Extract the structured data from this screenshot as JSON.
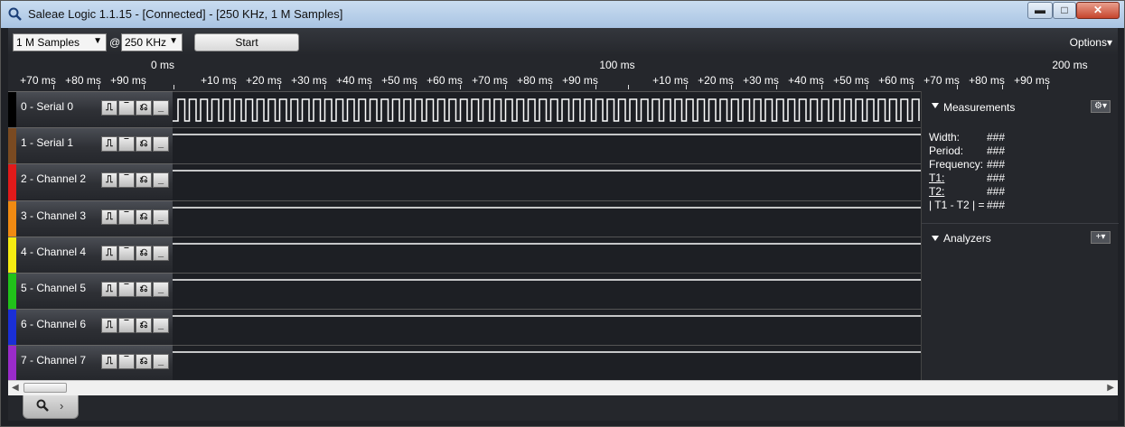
{
  "window": {
    "title": "Saleae Logic 1.1.15 - [Connected] - [250 KHz, 1 M Samples]",
    "minimize_glyph": "▬",
    "maximize_glyph": "□",
    "close_glyph": "✕"
  },
  "toolbar": {
    "samples_value": "1 M Samples",
    "at_sign": "@",
    "rate_value": "250 KHz",
    "start_label": "Start",
    "options_label": "Options▾"
  },
  "ruler": {
    "major_labels": [
      "0 ms",
      "100 ms",
      "200 ms"
    ],
    "minor_labels": [
      "+70 ms",
      "+80 ms",
      "+90 ms",
      "+10 ms",
      "+20 ms",
      "+30 ms",
      "+40 ms",
      "+50 ms",
      "+60 ms",
      "+70 ms",
      "+80 ms",
      "+90 ms",
      "+10 ms",
      "+20 ms",
      "+30 ms",
      "+40 ms",
      "+50 ms",
      "+60 ms",
      "+70 ms",
      "+80 ms",
      "+90 ms"
    ]
  },
  "channels": [
    {
      "name": "0 - Serial 0",
      "color": "#000000",
      "active": true
    },
    {
      "name": "1 - Serial 1",
      "color": "#7a4a21",
      "active": false
    },
    {
      "name": "2 - Channel 2",
      "color": "#e11a1a",
      "active": false
    },
    {
      "name": "3 - Channel 3",
      "color": "#f08a12",
      "active": false
    },
    {
      "name": "4 - Channel 4",
      "color": "#f5ec12",
      "active": false
    },
    {
      "name": "5 - Channel 5",
      "color": "#21c21a",
      "active": false
    },
    {
      "name": "6 - Channel 6",
      "color": "#1a2fd6",
      "active": false
    },
    {
      "name": "7 - Channel 7",
      "color": "#9a2bc9",
      "active": false
    }
  ],
  "trigger_buttons": [
    "⎍",
    "‾",
    "⎌",
    "_"
  ],
  "measurements": {
    "title": "Measurements",
    "rows": [
      {
        "key": "Width:",
        "value": "###"
      },
      {
        "key": "Period:",
        "value": "###"
      },
      {
        "key": "Frequency:",
        "value": "###"
      },
      {
        "key": "T1:",
        "value": "###"
      },
      {
        "key": "T2:",
        "value": "###"
      },
      {
        "key": "| T1 - T2 | =",
        "value": "###"
      }
    ]
  },
  "analyzers": {
    "title": "Analyzers",
    "add_glyph": "+▾"
  },
  "icons": {
    "gear": "⚙▾",
    "search": "🔍",
    "chevron": "›"
  }
}
